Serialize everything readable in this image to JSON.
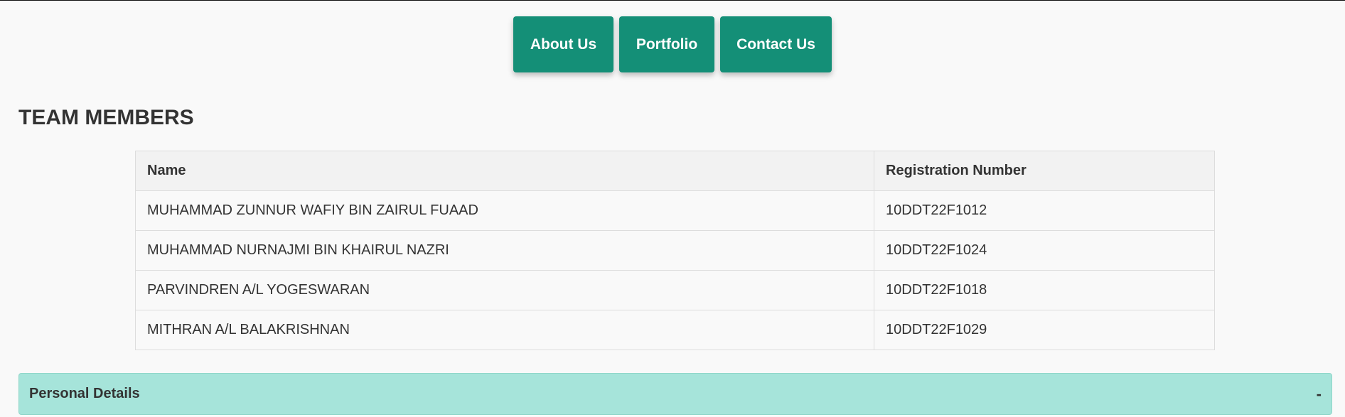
{
  "nav": {
    "items": [
      {
        "label": "About Us"
      },
      {
        "label": "Portfolio"
      },
      {
        "label": "Contact Us"
      }
    ]
  },
  "team": {
    "title": "TEAM MEMBERS",
    "columns": [
      "Name",
      "Registration Number"
    ],
    "rows": [
      {
        "name": "MUHAMMAD ZUNNUR WAFIY BIN ZAIRUL FUAAD",
        "reg": "10DDT22F1012"
      },
      {
        "name": "MUHAMMAD NURNAJMI BIN KHAIRUL NAZRI",
        "reg": "10DDT22F1024"
      },
      {
        "name": "PARVINDREN A/L YOGESWARAN",
        "reg": "10DDT22F1018"
      },
      {
        "name": "MITHRAN A/L BALAKRISHNAN",
        "reg": "10DDT22F1029"
      }
    ]
  },
  "accordion": {
    "title": "Personal Details",
    "toggle": "-"
  },
  "colors": {
    "nav_button": "#148f77",
    "accordion_bg": "#a6e4da",
    "page_bg": "#f9f9f9"
  }
}
